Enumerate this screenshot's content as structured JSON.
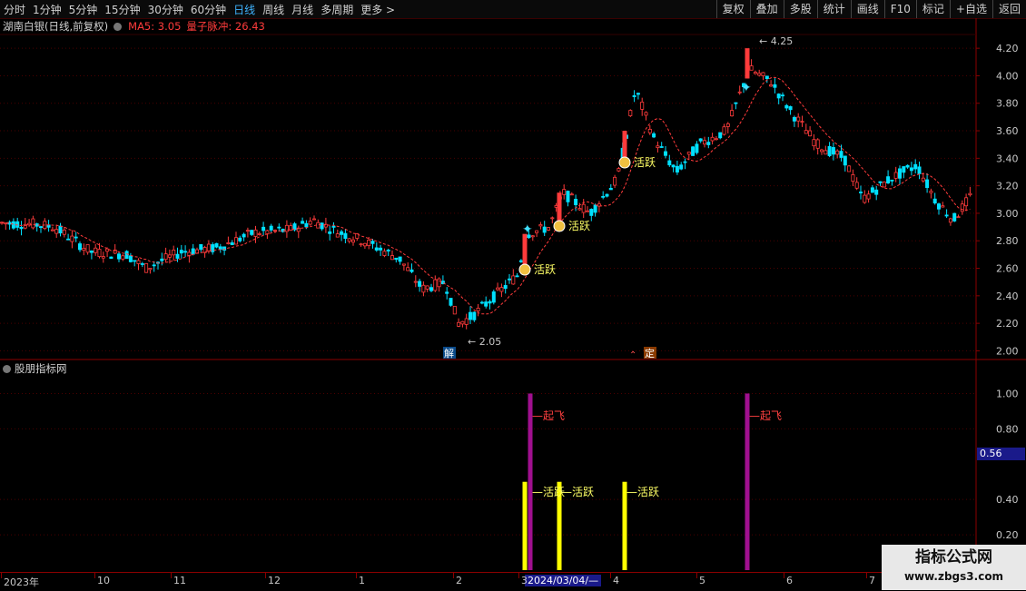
{
  "toolbar": {
    "tabs": [
      "分时",
      "1分钟",
      "5分钟",
      "15分钟",
      "30分钟",
      "60分钟",
      "日线",
      "周线",
      "月线",
      "多周期",
      "更多 >"
    ],
    "active_tab": "日线",
    "right_buttons": [
      "复权",
      "叠加",
      "多股",
      "统计",
      "画线",
      "F10",
      "标记",
      "+自选",
      "返回"
    ]
  },
  "header": {
    "stock": "湖南白银(日线,前复权)",
    "ma5": "MA5: 3.05",
    "quantum": "量子脉冲: 26.43"
  },
  "indicator_header": "股朋指标网",
  "price_axis": [
    "4.20",
    "4.00",
    "3.80",
    "3.60",
    "3.40",
    "3.20",
    "3.00",
    "2.80",
    "2.60",
    "2.40",
    "2.20",
    "2.00"
  ],
  "indicator_axis": [
    "1.00",
    "0.80",
    "0.40",
    "0.20"
  ],
  "cursor_value": "0.56",
  "annotations": {
    "high": "4.25",
    "low": "2.05",
    "jie": "解",
    "ding": "定",
    "active": "活跃",
    "takeoff": "起飞"
  },
  "date_axis": [
    "2023年",
    "10",
    "11",
    "12",
    "1",
    "2",
    "3",
    "4",
    "5",
    "6",
    "7"
  ],
  "date_selected": "2024/03/04/—",
  "watermark": {
    "title": "指标公式网",
    "url": "www.zbgs3.com"
  },
  "colors": {
    "up": "#ff3b3b",
    "down": "#00e0ff",
    "ma": "#ff3b3b",
    "purple": "#a0108f",
    "yellow": "#ffff00"
  },
  "chart_data": {
    "type": "candlestick",
    "ylim": [
      1.95,
      4.3
    ],
    "high_label": 4.25,
    "low_label": 2.05,
    "indicator": {
      "ylim": [
        0,
        1.1
      ],
      "bars": [
        {
          "name": "活跃",
          "value": 0.5
        },
        {
          "name": "起飞",
          "value": 1.0
        },
        {
          "name": "活跃",
          "value": 0.5
        },
        {
          "name": "活跃",
          "value": 0.5
        },
        {
          "name": "起飞",
          "value": 1.0
        }
      ]
    }
  }
}
